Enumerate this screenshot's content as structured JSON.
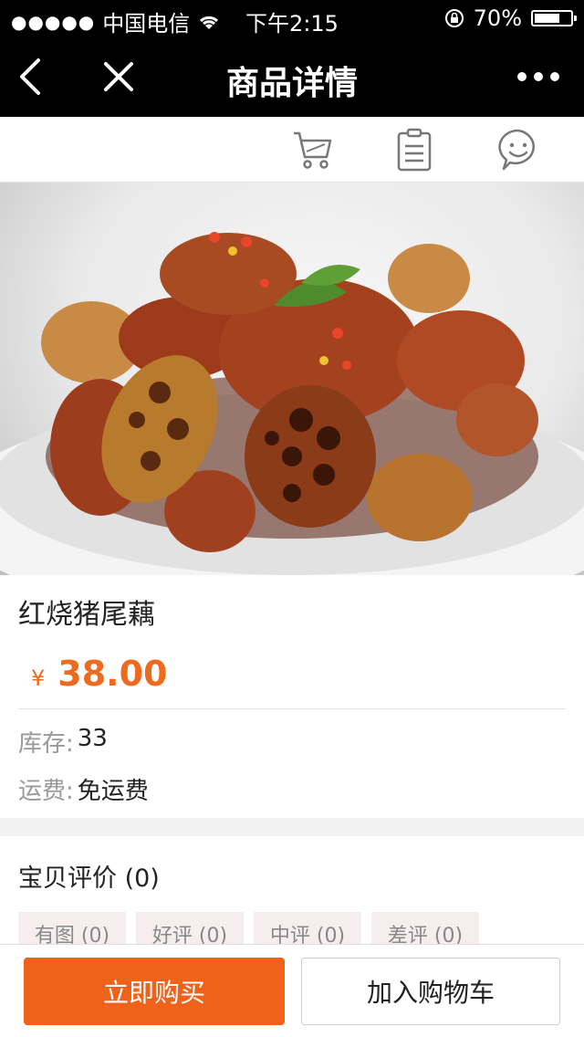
{
  "status_bar": {
    "carrier": "中国电信",
    "time": "下午2:15",
    "battery": "70%",
    "battery_level": 0.7
  },
  "nav": {
    "title": "商品详情"
  },
  "toolbar": {
    "icons": [
      "cart-icon",
      "clipboard-icon",
      "smiley-icon"
    ]
  },
  "product": {
    "name": "红烧猪尾藕",
    "currency": "¥",
    "price": "38.00",
    "stock_label": "库存:",
    "stock_value": "33",
    "shipping_label": "运费:",
    "shipping_value": "免运费"
  },
  "reviews": {
    "heading": "宝贝评价 (0)",
    "tags": [
      "有图 (0)",
      "好评 (0)",
      "中评 (0)",
      "差评 (0)"
    ]
  },
  "actions": {
    "buy_now": "立即购买",
    "add_to_cart": "加入购物车"
  },
  "colors": {
    "accent": "#f0611a",
    "price": "#ef6a1c"
  }
}
